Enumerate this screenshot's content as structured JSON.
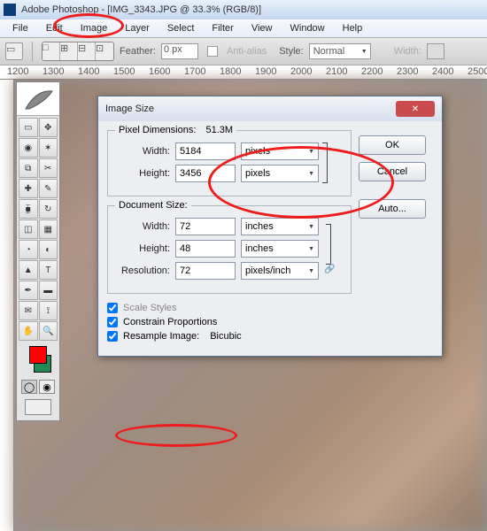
{
  "window": {
    "title": "Adobe Photoshop - [IMG_3343.JPG @ 33.3% (RGB/8)]"
  },
  "menu": [
    "File",
    "Edit",
    "Image",
    "Layer",
    "Select",
    "Filter",
    "View",
    "Window",
    "Help"
  ],
  "options": {
    "feather_label": "Feather:",
    "feather_value": "0 px",
    "antialias": "Anti-alias",
    "style_label": "Style:",
    "style_value": "Normal",
    "width_label": "Width:"
  },
  "ruler": {
    "top": [
      "1200",
      "1300",
      "1400",
      "1500",
      "1600",
      "1700",
      "1800",
      "1900",
      "2000",
      "2100",
      "2200",
      "2300",
      "2400",
      "2500"
    ]
  },
  "dialog": {
    "title": "Image Size",
    "pixel_legend": "Pixel Dimensions:",
    "pixel_size": "51.3M",
    "width_label": "Width:",
    "height_label": "Height:",
    "px_width": "5184",
    "px_height": "3456",
    "px_unit": "pixels",
    "doc_legend": "Document Size:",
    "doc_width": "72",
    "doc_height": "48",
    "doc_unit": "inches",
    "res_label": "Resolution:",
    "res_value": "72",
    "res_unit": "pixels/inch",
    "scale_styles": "Scale Styles",
    "constrain": "Constrain Proportions",
    "resample": "Resample Image:",
    "resample_method": "Bicubic",
    "ok": "OK",
    "cancel": "Cancel",
    "auto": "Auto..."
  }
}
